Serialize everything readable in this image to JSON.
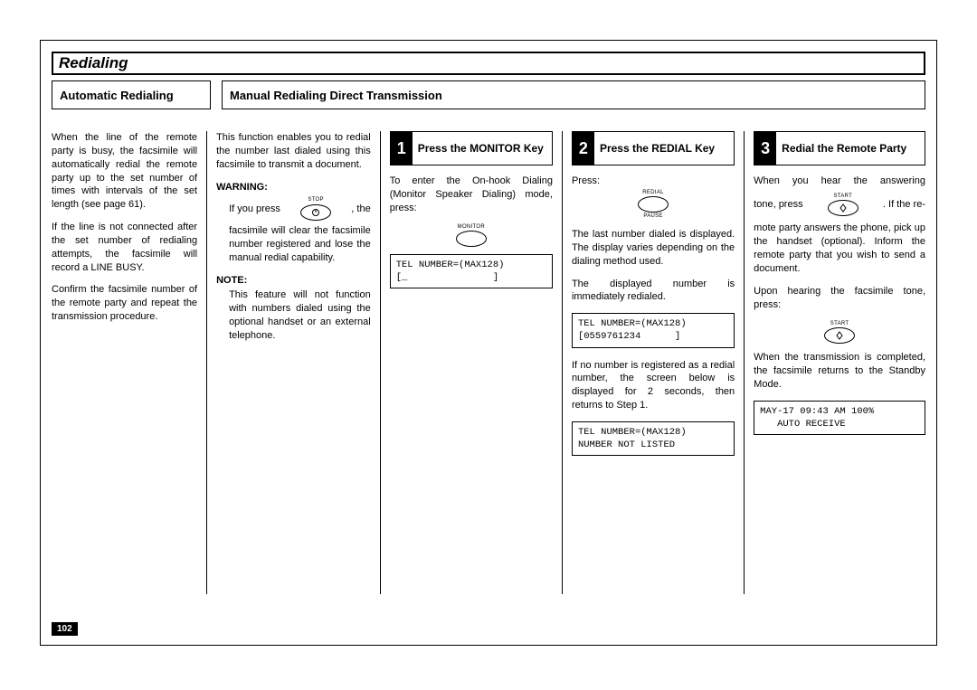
{
  "title": "Redialing",
  "subheads": {
    "auto": "Automatic Redialing",
    "manual": "Manual Redialing Direct Transmission"
  },
  "col1": {
    "p1": "When the line of the remote party is busy, the facsimile will automatically redial the remote party up to the set number of times with intervals of the set length (see page 61).",
    "p2": "If the line is not connected after the set number of redialing attempts, the facsimile will record a LINE BUSY.",
    "p3": "Confirm the facsimile number of the remote party and repeat the transmission procedure."
  },
  "col2": {
    "p1": "This function enables you to redial the number last dialed using this facsimile to transmit a document.",
    "warning_hdr": "WARNING:",
    "warn_a": "If  you  press",
    "warn_b": ",  the",
    "warn_c": "facsimile will clear the facsimile number registered and lose the manual redial capability.",
    "note_hdr": "NOTE:",
    "note_body": "This feature will not function with numbers dialed using the optional handset or an external telephone.",
    "stop_label": "STOP"
  },
  "step1": {
    "num": "1",
    "label": "Press the MONITOR Key",
    "p1": "To enter the On-hook Dialing (Monitor Speaker Dialing) mode, press:",
    "monitor_label": "MONITOR",
    "lcd": "TEL NUMBER=(MAX128)\n[_               ]"
  },
  "step2": {
    "num": "2",
    "label": "Press the REDIAL Key",
    "p1": "Press:",
    "redial_label": "REDIAL",
    "pause_label": "PAUSE",
    "p2": "The last number dialed is displayed. The display varies depending on the dialing method used.",
    "p3": "The displayed number is immediately redialed.",
    "lcd1": "TEL NUMBER=(MAX128)\n[0559761234      ]",
    "p4": "If no number is registered as a redial number, the screen below is displayed for 2 seconds, then returns to Step 1.",
    "lcd2": "TEL NUMBER=(MAX128)\nNUMBER NOT LISTED"
  },
  "step3": {
    "num": "3",
    "label": "Redial the Remote Party",
    "p1a": "When you hear the answering",
    "p1b": "tone, press",
    "p1c": ".   If the re-",
    "p2": "mote party answers the phone, pick up the handset (optional). Inform the remote party that you wish to send a document.",
    "p3": "Upon hearing the facsimile tone, press:",
    "start_label": "START",
    "p4": "When the transmission is completed, the facsimile returns to the Standby Mode.",
    "lcd": "MAY-17 09:43 AM 100%\n   AUTO RECEIVE"
  },
  "page_number": "102"
}
